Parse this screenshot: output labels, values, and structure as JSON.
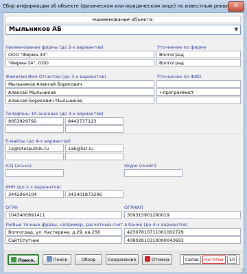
{
  "window": {
    "title": "Сбор информации об объекте (физическом или юридическом лице) по известным реквизитам",
    "close_glyph": "✕"
  },
  "object_name": {
    "label": "Наименование объекта:",
    "value": "Мыльников АБ"
  },
  "company": {
    "label": "Наименование фирмы (до 2-х вариантов)",
    "clarify_label": "Уточнение по фирме",
    "rows": [
      {
        "name": "ООО \"Фирма-34\"",
        "clarify": "Волгоград"
      },
      {
        "name": "\"Фирма-34\", ООО",
        "clarify": "Волгоград"
      }
    ]
  },
  "person": {
    "label": "Фамилия Имя Отчество (до 3-х вариантов)",
    "clarify_label": "Уточнение по ФИО",
    "rows": [
      {
        "name": "Мыльников Алексей Борисович",
        "clarify": ""
      },
      {
        "name": "Алексей Мыльников",
        "clarify": "+программист"
      },
      {
        "name": "Алексей Борисович Мыльников",
        "clarify": ""
      }
    ]
  },
  "phones": {
    "label": "Телефоны 10-значные (до 4-х вариантов)",
    "values": [
      "9053929792",
      "8442737123",
      "",
      ""
    ]
  },
  "emails": {
    "label": "E-майлы (до 4-х вариантов)",
    "values": [
      "1a@sitesputnik.ru",
      "1ab@list.ru",
      "",
      ""
    ]
  },
  "icq": {
    "label": "ICQ (аська)",
    "value": ""
  },
  "skype": {
    "label": "Skype (скайп)",
    "value": ""
  },
  "inn": {
    "label": "ИНН (до 2-х вариантов)",
    "values": [
      "3442064104",
      "343401873206"
    ]
  },
  "ogrn": {
    "label": "ОГРН",
    "value": "1043400991411"
  },
  "ogrnip": {
    "label": "ОГРНИП",
    "value": "309315901200019"
  },
  "phrases": {
    "label": "Любые точные фразы, например, расчетный счет в банке (до 4-х вариантов)",
    "rows": [
      {
        "left": "Волгоград, ул. Кастерина, д.29, кв.256",
        "right": "42307810711001002729"
      },
      {
        "left": "СайтСпутник",
        "right": "40802810310000043693"
      }
    ]
  },
  "buttons": {
    "search": "Поиск.",
    "search2": "Поиск",
    "review": "Обзор",
    "save": "Сохранение",
    "cancel": "Отмена",
    "links": "Связи",
    "negative": "Негатив",
    "count": "10"
  },
  "colors": {
    "label_blue": "#2d3d9a",
    "search_border": "#2c7d2c",
    "negative_red": "#d0212a"
  }
}
